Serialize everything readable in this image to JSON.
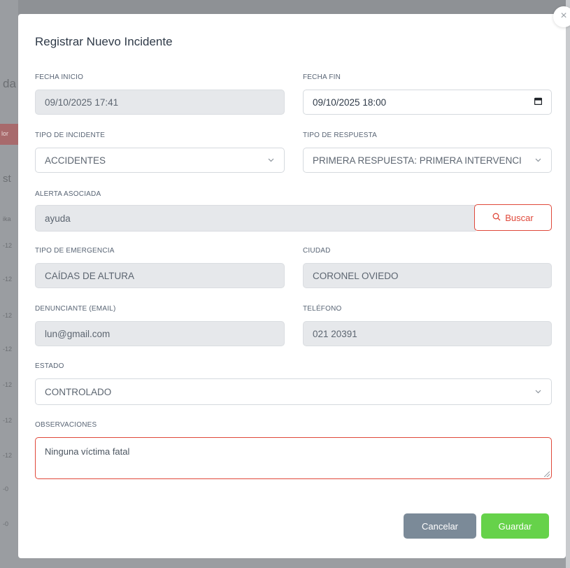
{
  "background": {
    "fragments": [
      "da",
      "lor",
      "st",
      "ika",
      "-12",
      "-12",
      "-12",
      "-12",
      "-12",
      "-12",
      "-12",
      "-0",
      "-0"
    ]
  },
  "modal": {
    "title": "Registrar Nuevo Incidente",
    "close_label": "×"
  },
  "fields": {
    "fecha_inicio": {
      "label": "FECHA INICIO",
      "value": "09/10/2025 17:41"
    },
    "fecha_fin": {
      "label": "FECHA FIN",
      "value": "09/10/2025 18:00"
    },
    "tipo_incidente": {
      "label": "TIPO DE INCIDENTE",
      "value": "ACCIDENTES"
    },
    "tipo_respuesta": {
      "label": "TIPO DE RESPUESTA",
      "value": "PRIMERA RESPUESTA: PRIMERA INTERVENCI"
    },
    "alerta_asociada": {
      "label": "ALERTA ASOCIADA",
      "value": "ayuda"
    },
    "tipo_emergencia": {
      "label": "TIPO DE EMERGENCIA",
      "value": "CAÍDAS DE ALTURA"
    },
    "ciudad": {
      "label": "CIUDAD",
      "value": "CORONEL OVIEDO"
    },
    "denunciante": {
      "label": "DENUNCIANTE (EMAIL)",
      "value": "lun@gmail.com"
    },
    "telefono": {
      "label": "TELÉFONO",
      "value": "021 20391"
    },
    "estado": {
      "label": "ESTADO",
      "value": "CONTROLADO"
    },
    "observaciones": {
      "label": "OBSERVACIONES",
      "value": "Ninguna víctima fatal"
    }
  },
  "buttons": {
    "buscar": "Buscar",
    "cancelar": "Cancelar",
    "guardar": "Guardar"
  },
  "colors": {
    "accent_red": "#e0483a",
    "save_green": "#66d24a",
    "cancel_gray": "#7b8a98"
  }
}
